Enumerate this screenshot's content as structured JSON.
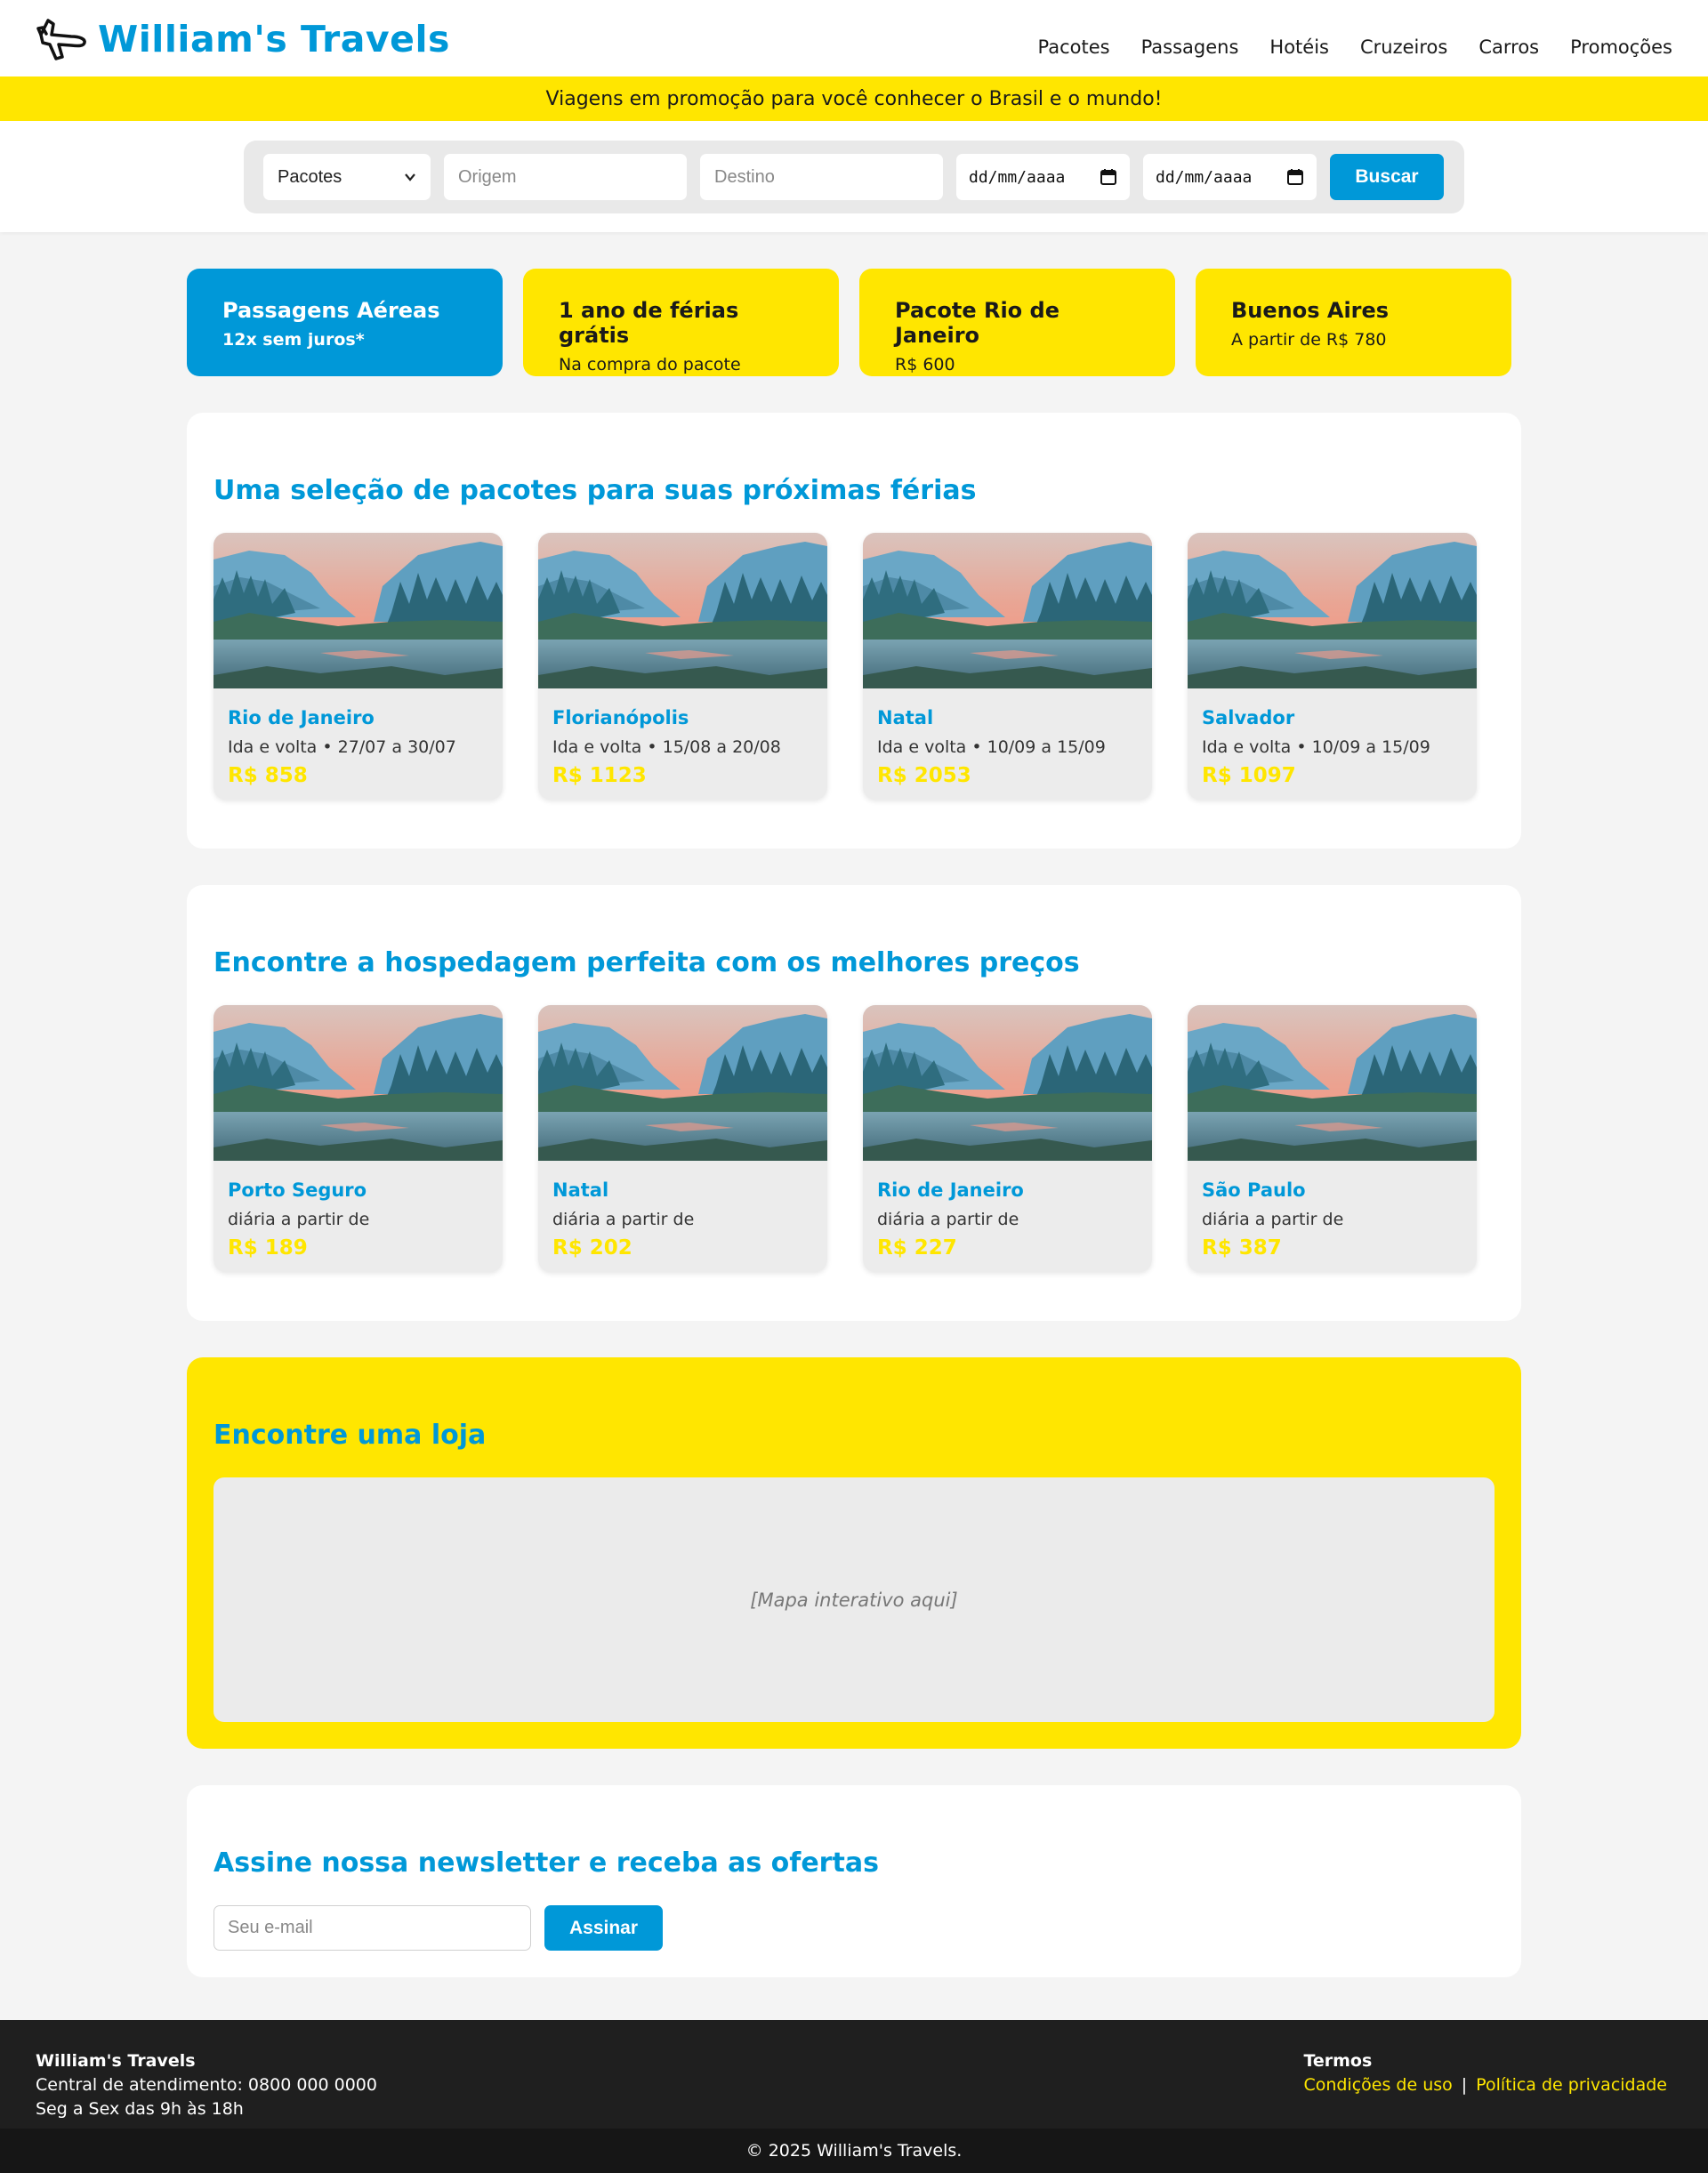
{
  "header": {
    "brand": "William's Travels",
    "nav": [
      "Pacotes",
      "Passagens",
      "Hotéis",
      "Cruzeiros",
      "Carros",
      "Promoções"
    ]
  },
  "promo_bar": "Viagens em promoção para você conhecer o Brasil e o mundo!",
  "search": {
    "type_selected": "Pacotes",
    "origin_placeholder": "Origem",
    "dest_placeholder": "Destino",
    "date_placeholder": "dd/mm/aaaa",
    "button": "Buscar"
  },
  "highlights": [
    {
      "title": "Passagens Aéreas",
      "sub": "12x sem juros*"
    },
    {
      "title": "1 ano de férias grátis",
      "sub": "Na compra do pacote"
    },
    {
      "title": "Pacote Rio de Janeiro",
      "sub": "R$ 600"
    },
    {
      "title": "Buenos Aires",
      "sub": "A partir de R$ 780"
    }
  ],
  "packages": {
    "title": "Uma seleção de pacotes para suas próximas férias",
    "items": [
      {
        "city": "Rio de Janeiro",
        "desc": "Ida e volta • 27/07 a 30/07",
        "price": "R$ 858"
      },
      {
        "city": "Florianópolis",
        "desc": "Ida e volta • 15/08 a 20/08",
        "price": "R$ 1123"
      },
      {
        "city": "Natal",
        "desc": "Ida e volta • 10/09 a 15/09",
        "price": "R$ 2053"
      },
      {
        "city": "Salvador",
        "desc": "Ida e volta • 10/09 a 15/09",
        "price": "R$ 1097"
      }
    ]
  },
  "hotels": {
    "title": "Encontre a hospedagem perfeita com os melhores preços",
    "items": [
      {
        "city": "Porto Seguro",
        "desc": "diária a partir de",
        "price": "R$ 189"
      },
      {
        "city": "Natal",
        "desc": "diária a partir de",
        "price": "R$ 202"
      },
      {
        "city": "Rio de Janeiro",
        "desc": "diária a partir de",
        "price": "R$ 227"
      },
      {
        "city": "São Paulo",
        "desc": "diária a partir de",
        "price": "R$ 387"
      }
    ]
  },
  "store": {
    "title": "Encontre uma loja",
    "map_text": "[Mapa interativo aqui]"
  },
  "newsletter": {
    "title": "Assine nossa newsletter e receba as ofertas",
    "placeholder": "Seu e-mail",
    "button": "Assinar"
  },
  "footer": {
    "brand": "William's Travels",
    "phone": "Central de atendimento: 0800 000 0000",
    "hours": "Seg a Sex das 9h às 18h",
    "terms_title": "Termos",
    "link_conditions": "Condições de uso",
    "separator": "|",
    "link_privacy": "Política de privacidade",
    "copyright": "© 2025 William's Travels."
  },
  "colors": {
    "brand_blue": "#0098d8",
    "brand_yellow": "#ffe600",
    "footer_dark": "#1f1f1f"
  }
}
